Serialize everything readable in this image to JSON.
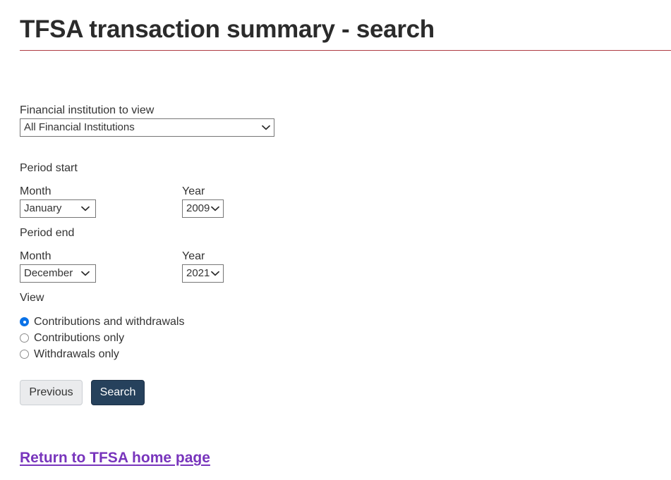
{
  "header": {
    "title": "TFSA transaction summary - search",
    "rule_color": "#af3c43"
  },
  "form": {
    "institution": {
      "label": "Financial institution to view",
      "value": "All Financial Institutions",
      "icon": "chevron-down-icon"
    },
    "period_start": {
      "heading": "Period start",
      "month_label": "Month",
      "month_value": "January",
      "year_label": "Year",
      "year_value": "2009"
    },
    "period_end": {
      "heading": "Period end",
      "month_label": "Month",
      "month_value": "December",
      "year_label": "Year",
      "year_value": "2021"
    },
    "view": {
      "heading": "View",
      "selected_index": 0,
      "options": [
        "Contributions and withdrawals",
        "Contributions only",
        "Withdrawals only"
      ]
    }
  },
  "actions": {
    "previous_label": "Previous",
    "search_label": "Search",
    "search_color": "#26415c"
  },
  "footer": {
    "home_link": "Return to TFSA home page",
    "link_color": "#7834bc"
  }
}
